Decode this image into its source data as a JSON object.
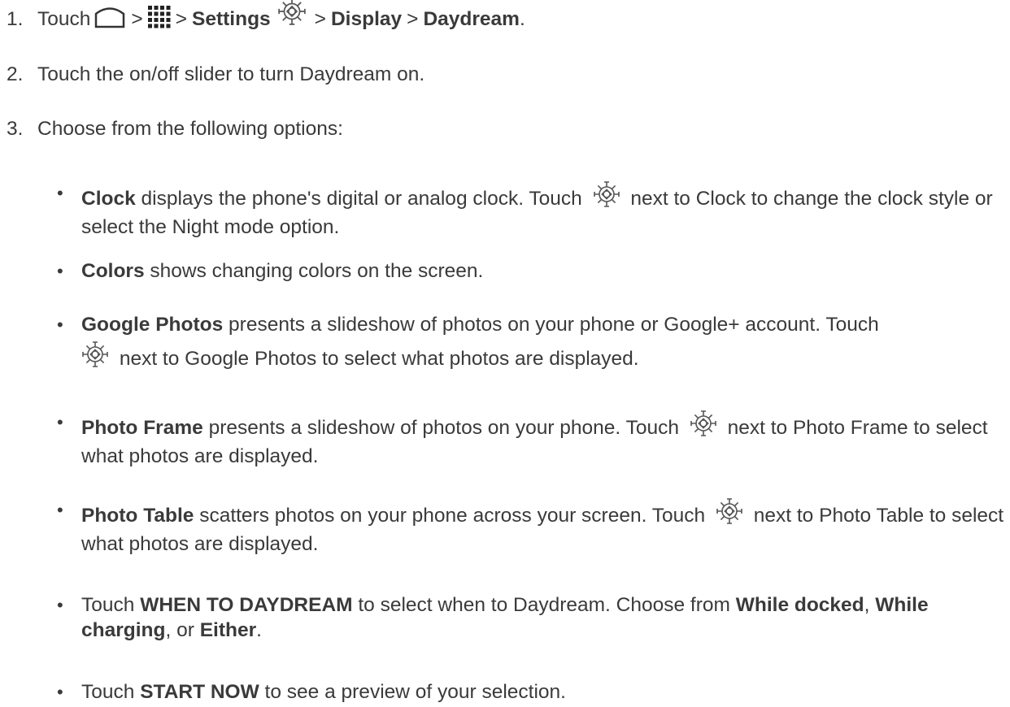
{
  "steps": [
    {
      "number": "1.",
      "touch": "Touch",
      "sep1": ">",
      "sep2": ">",
      "settings": "Settings",
      "sep3": ">",
      "display": "Display",
      "sep4": ">",
      "daydream": "Daydream",
      "end": "."
    },
    {
      "number": "2.",
      "text": "Touch the on/off slider to turn Daydream on."
    },
    {
      "number": "3.",
      "text": "Choose from the following options:"
    }
  ],
  "options": {
    "clock": {
      "bold": "Clock",
      "text1": "displays the phone's digital or analog clock. Touch",
      "text2": "next to Clock to change the clock style or select the Night mode option."
    },
    "colors": {
      "bold": "Colors",
      "text1": "shows changing colors on the screen."
    },
    "google_photos": {
      "bold": "Google Photos",
      "text1": "presents a slideshow of photos on your phone or Google+ account. Touch",
      "text2": "next to Google Photos to select what photos are displayed."
    },
    "photo_frame": {
      "bold": "Photo Frame",
      "text1": "presents a slideshow of photos on your phone. Touch",
      "text2": "next to Photo Frame to select what photos are displayed."
    },
    "photo_table": {
      "bold": "Photo Table",
      "text1": "scatters photos on your phone across your screen. Touch",
      "text2": "next to Photo Table to select what photos are displayed."
    },
    "when": {
      "t1": "Touch",
      "b1": "WHEN TO DAYDREAM",
      "t2": "to select when to Daydream. Choose from",
      "b2": "While docked",
      "t3": ",",
      "b3": "While charging",
      "t4": ", or",
      "b4": "Either",
      "t5": "."
    },
    "start": {
      "t1": "Touch",
      "b1": "START NOW",
      "t2": "to see a preview of your selection."
    }
  },
  "bullet_char": "•",
  "icons": [
    "home-icon",
    "apps-icon",
    "settings-icon",
    "gear-icon"
  ]
}
